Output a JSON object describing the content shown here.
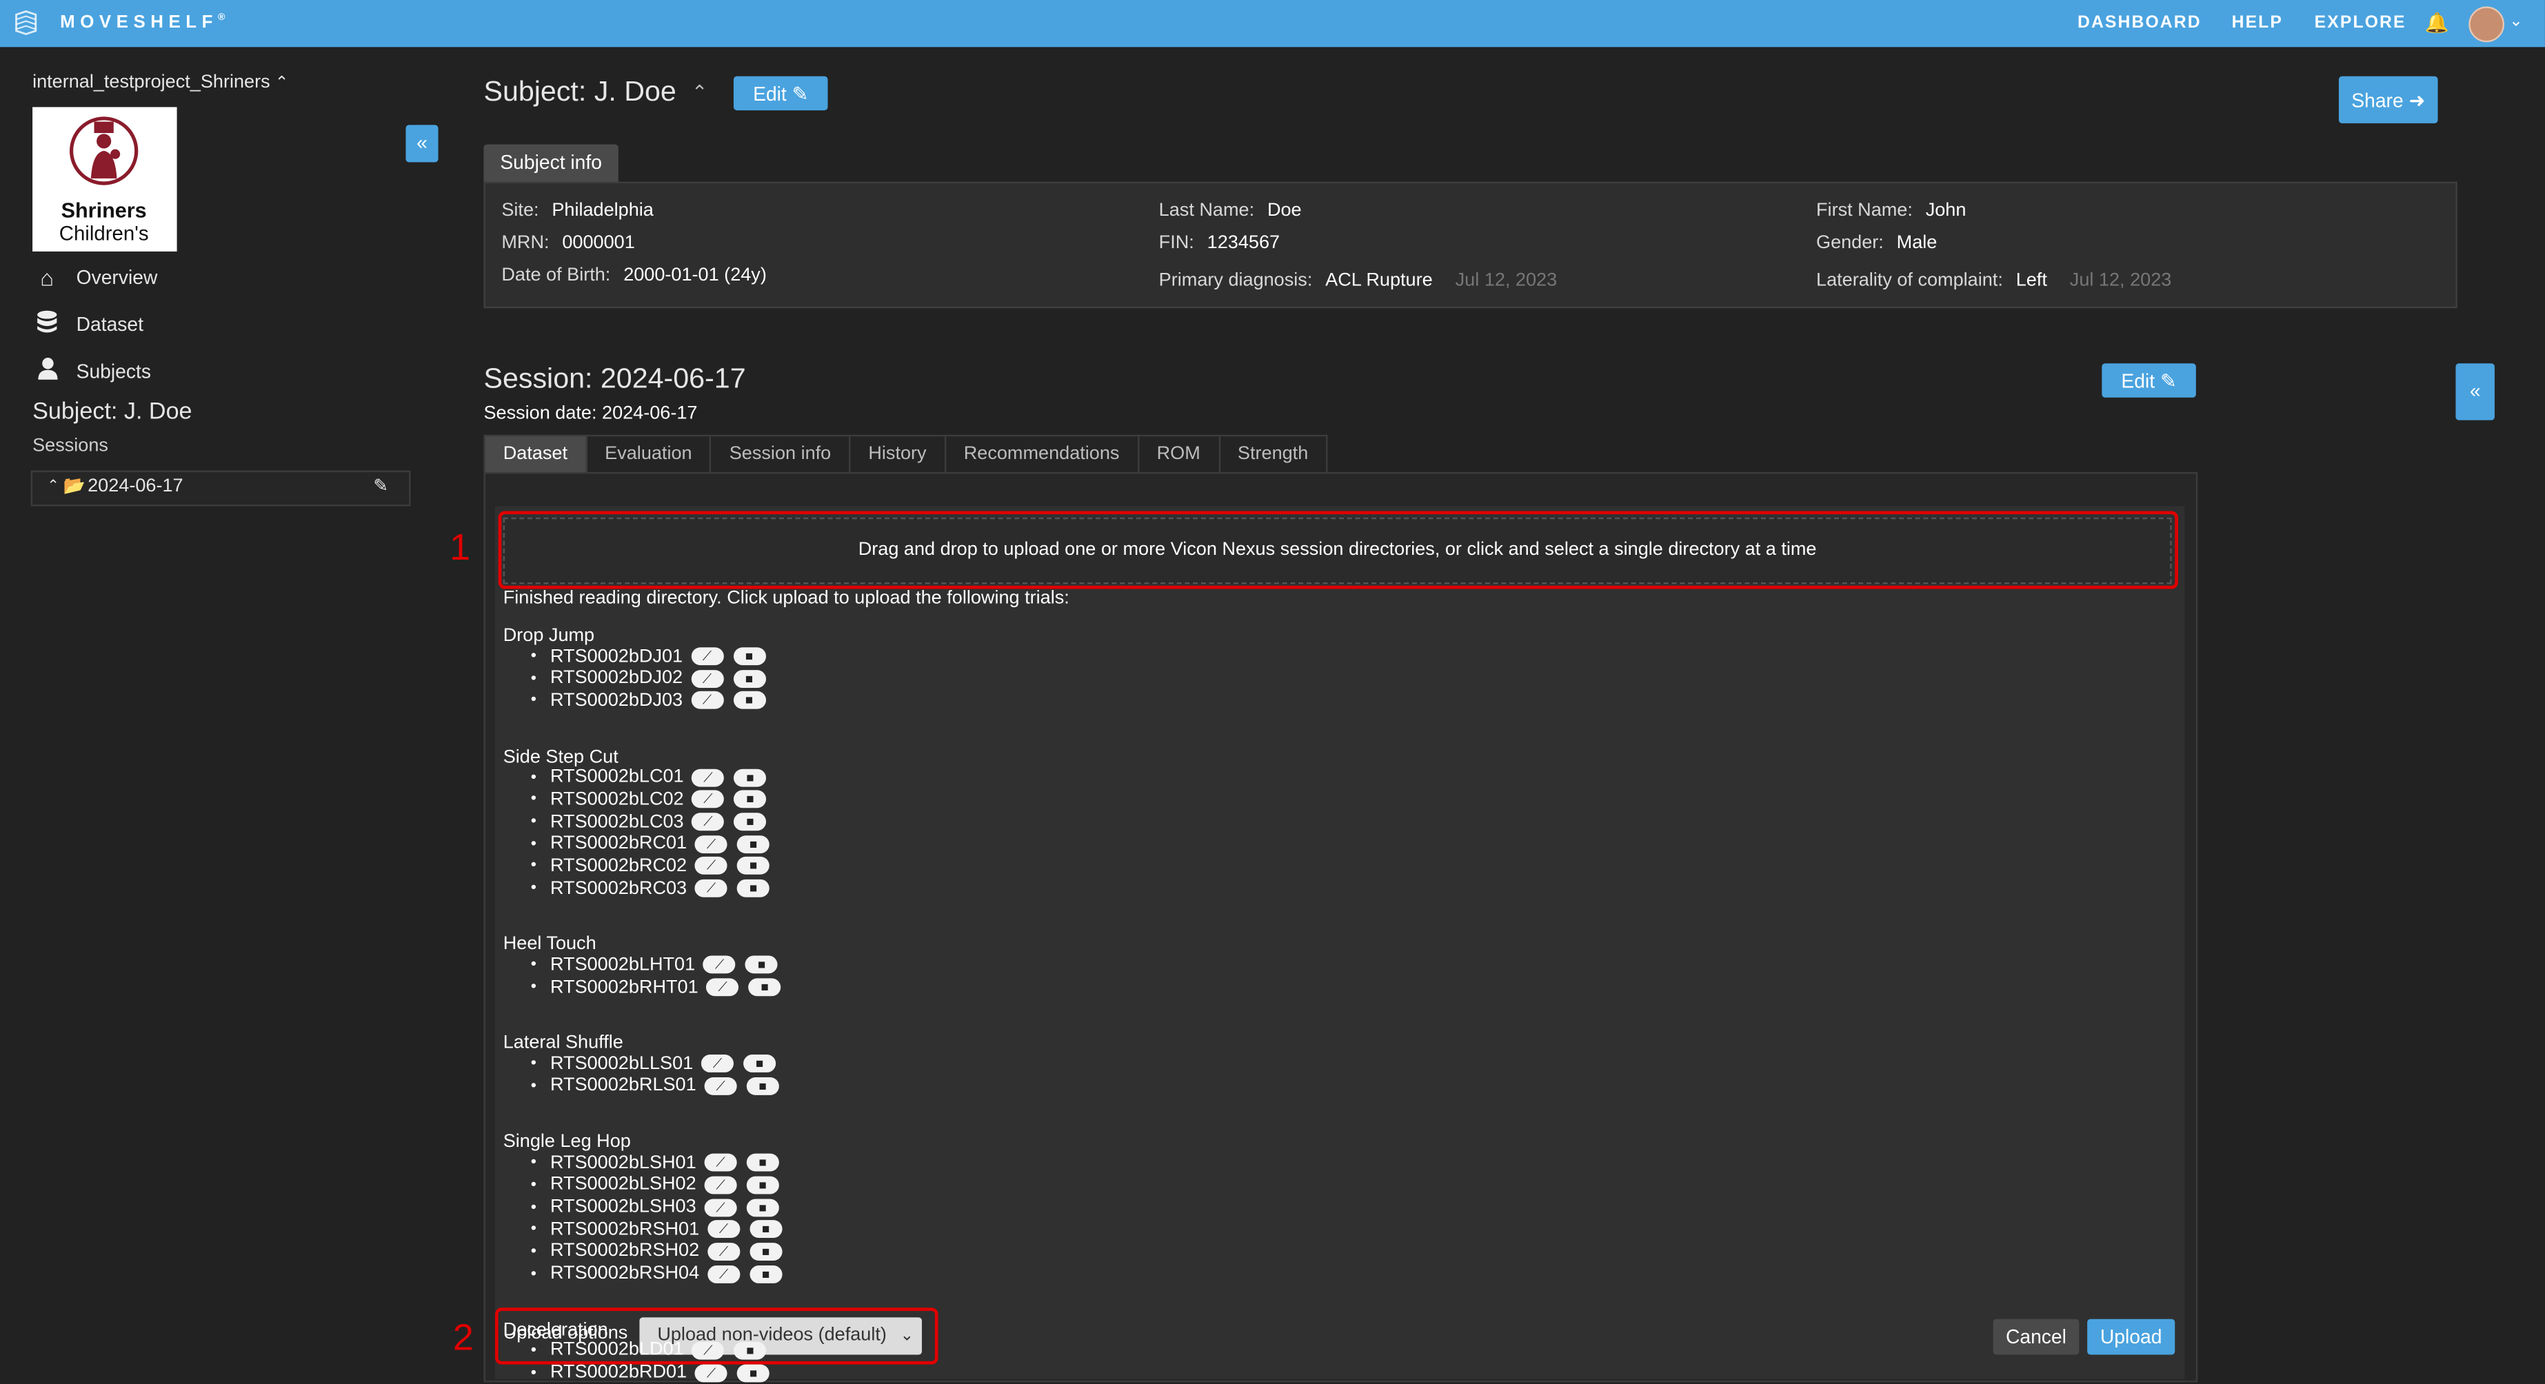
{
  "topbar": {
    "brand": "MOVESHELF",
    "brand_mark": "®",
    "nav": [
      "DASHBOARD",
      "HELP",
      "EXPLORE"
    ],
    "bell_icon": "bell-icon",
    "avatar_icon": "user-avatar",
    "accent_color": "#4aa3df"
  },
  "sidebar": {
    "project": "internal_testproject_Shriners",
    "logo_text_1": "Shriners",
    "logo_text_2": "Children's",
    "items": [
      {
        "label": "Overview",
        "icon": "home-icon"
      },
      {
        "label": "Dataset",
        "icon": "database-icon"
      },
      {
        "label": "Subjects",
        "icon": "user-icon"
      }
    ],
    "subject": "Subject: J. Doe",
    "sessions_label": "Sessions",
    "session": "2024-06-17"
  },
  "header": {
    "subject_title": "Subject: J. Doe",
    "edit_label": "Edit",
    "share_label": "Share",
    "subject_tab": "Subject info"
  },
  "subject_info": {
    "site": {
      "label": "Site:",
      "value": "Philadelphia"
    },
    "mrn": {
      "label": "MRN:",
      "value": "0000001"
    },
    "dob": {
      "label": "Date of Birth:",
      "value": "2000-01-01 (24y)"
    },
    "last_name": {
      "label": "Last Name:",
      "value": "Doe"
    },
    "fin": {
      "label": "FIN:",
      "value": "1234567"
    },
    "primary_diagnosis": {
      "label": "Primary diagnosis:",
      "value": "ACL Rupture",
      "date": "Jul 12, 2023"
    },
    "first_name": {
      "label": "First Name:",
      "value": "John"
    },
    "gender": {
      "label": "Gender:",
      "value": "Male"
    },
    "laterality": {
      "label": "Laterality of complaint:",
      "value": "Left",
      "date": "Jul 12, 2023"
    }
  },
  "session": {
    "title": "Session: 2024-06-17",
    "date_line": "Session date: 2024-06-17",
    "edit_label": "Edit",
    "tabs": [
      "Dataset",
      "Evaluation",
      "Session info",
      "History",
      "Recommendations",
      "ROM",
      "Strength"
    ],
    "active_tab": "Dataset",
    "dropzone_text": "Drag and drop to upload one or more Vicon Nexus session directories, or click and select a single directory at a time",
    "finished_text": "Finished reading directory. Click upload to upload the following trials:",
    "groups": [
      {
        "name": "Drop Jump",
        "trials": [
          "RTS0002bDJ01",
          "RTS0002bDJ02",
          "RTS0002bDJ03"
        ]
      },
      {
        "name": "Side Step Cut",
        "trials": [
          "RTS0002bLC01",
          "RTS0002bLC02",
          "RTS0002bLC03",
          "RTS0002bRC01",
          "RTS0002bRC02",
          "RTS0002bRC03"
        ]
      },
      {
        "name": "Heel Touch",
        "trials": [
          "RTS0002bLHT01",
          "RTS0002bRHT01"
        ]
      },
      {
        "name": "Lateral Shuffle",
        "trials": [
          "RTS0002bLLS01",
          "RTS0002bRLS01"
        ]
      },
      {
        "name": "Single Leg Hop",
        "trials": [
          "RTS0002bLSH01",
          "RTS0002bLSH02",
          "RTS0002bLSH03",
          "RTS0002bRSH01",
          "RTS0002bRSH02",
          "RTS0002bRSH04"
        ]
      },
      {
        "name": "Deceleration",
        "trials": [
          "RTS0002bLD01",
          "RTS0002bRD01"
        ]
      }
    ],
    "upload_options_label": "Upload options",
    "upload_option_selected": "Upload non-videos (default)",
    "cancel_label": "Cancel",
    "upload_label": "Upload"
  },
  "annotations": {
    "box1": "1",
    "box2": "2",
    "color": "#e00000"
  }
}
